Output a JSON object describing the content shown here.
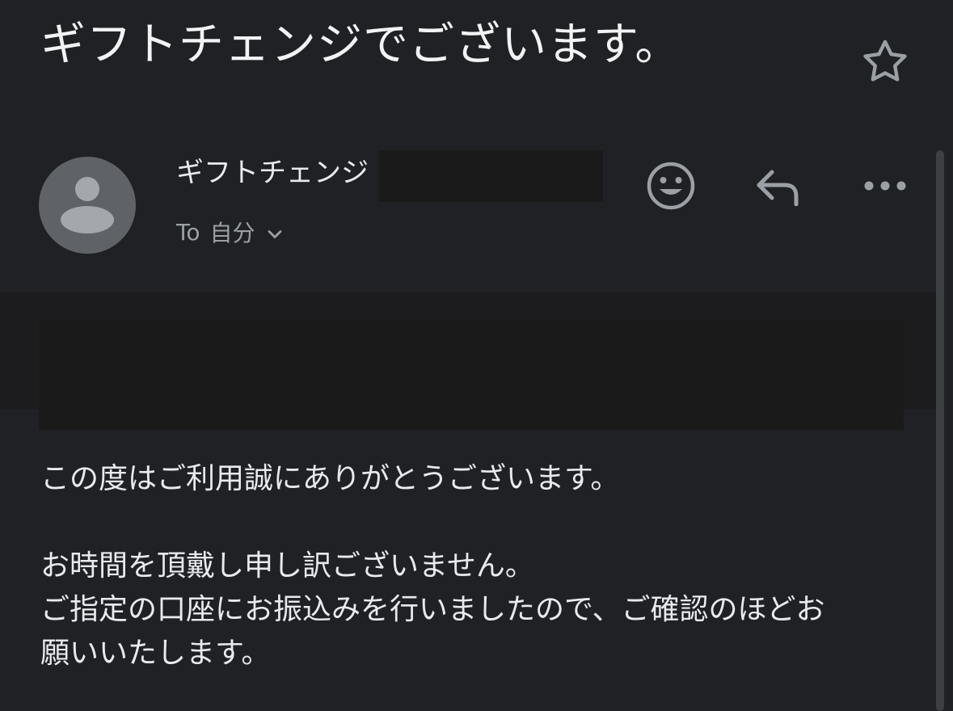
{
  "email": {
    "subject": "ギフトチェンジでございます。",
    "sender_name": "ギフトチェンジ",
    "recipient_prefix": "To",
    "recipient_name": "自分",
    "body": {
      "line1": "この度はご利用誠にありがとうございます。",
      "line2": "お時間を頂戴し申し訳ございません。",
      "line3": "ご指定の口座にお振込みを行いましたので、ご確認のほどお",
      "line4": "願いいたします。"
    }
  },
  "icons": {
    "star": "star-outline-icon",
    "emoji": "smiley-face-icon",
    "reply": "reply-arrow-icon",
    "more": "more-horizontal-icon",
    "avatar": "person-icon",
    "expand": "chevron-down-icon"
  },
  "colors": {
    "background": "#202124",
    "text_primary": "#e8eaed",
    "text_secondary": "#9aa0a6",
    "icon": "#9aa0a6",
    "avatar_bg": "#5f6368",
    "redaction": "#1a1a1a"
  }
}
